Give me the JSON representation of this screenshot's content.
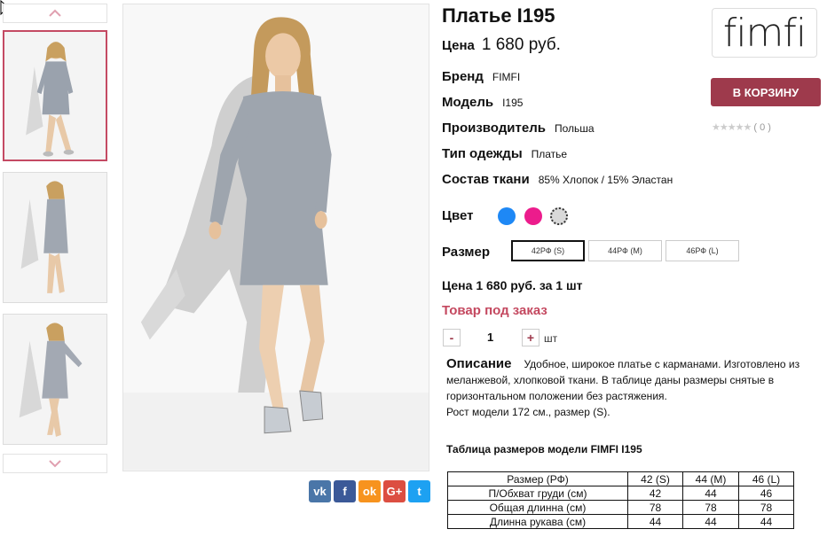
{
  "product": {
    "title": "Платье I195",
    "price_label": "Цена",
    "price_value": "1 680 руб."
  },
  "props": [
    {
      "label": "Бренд",
      "value": "FIMFI"
    },
    {
      "label": "Модель",
      "value": "I195"
    },
    {
      "label": "Производитель",
      "value": "Польша"
    },
    {
      "label": "Тип одежды",
      "value": "Платье"
    },
    {
      "label": "Состав ткани",
      "value": "85% Хлопок / 15% Эластан"
    }
  ],
  "brand_logo": "fimfi",
  "cart_button": "В КОРЗИНУ",
  "rating": {
    "stars": "★★★★★",
    "count": "( 0 )"
  },
  "color": {
    "label": "Цвет",
    "swatches": [
      "#1e88f5",
      "#ec1c8c",
      "#d9d9d9"
    ]
  },
  "size": {
    "label": "Размер",
    "options": [
      "42РФ (S)",
      "44РФ (M)",
      "46РФ (L)"
    ],
    "selected": "42РФ (S)"
  },
  "price_per_unit": "Цена 1 680 руб. за 1 шт",
  "order_status": "Товар под заказ",
  "quantity": {
    "minus": "-",
    "value": "1",
    "plus": "+",
    "unit": "шт"
  },
  "description": {
    "heading": "Описание",
    "text": "Удобное, широкое платье с карманами. Изготовлено из меланжевой, хлопковой ткани. В таблице даны размеры снятые в горизонтальном положении без растяжения.",
    "extra": "Рост модели 172 см., размер (S)."
  },
  "size_table": {
    "title": "Таблица размеров модели FIMFI I195",
    "header": [
      "Размер (РФ)",
      "42 (S)",
      "44 (M)",
      "46 (L)"
    ],
    "rows": [
      [
        "П/Обхват груди (см)",
        "42",
        "44",
        "46"
      ],
      [
        "Общая длинна (см)",
        "78",
        "78",
        "78"
      ],
      [
        "Длинна рукава (см)",
        "44",
        "44",
        "44"
      ]
    ]
  },
  "social": [
    {
      "name": "vk",
      "label": "vk",
      "color": "#4a76a8"
    },
    {
      "name": "facebook",
      "label": "f",
      "color": "#3b5998"
    },
    {
      "name": "odnoklassniki",
      "label": "ok",
      "color": "#f7931e"
    },
    {
      "name": "google-plus",
      "label": "G+",
      "color": "#dc4e41"
    },
    {
      "name": "twitter",
      "label": "t",
      "color": "#1da1f2"
    }
  ],
  "accent": "#9e3a4c"
}
